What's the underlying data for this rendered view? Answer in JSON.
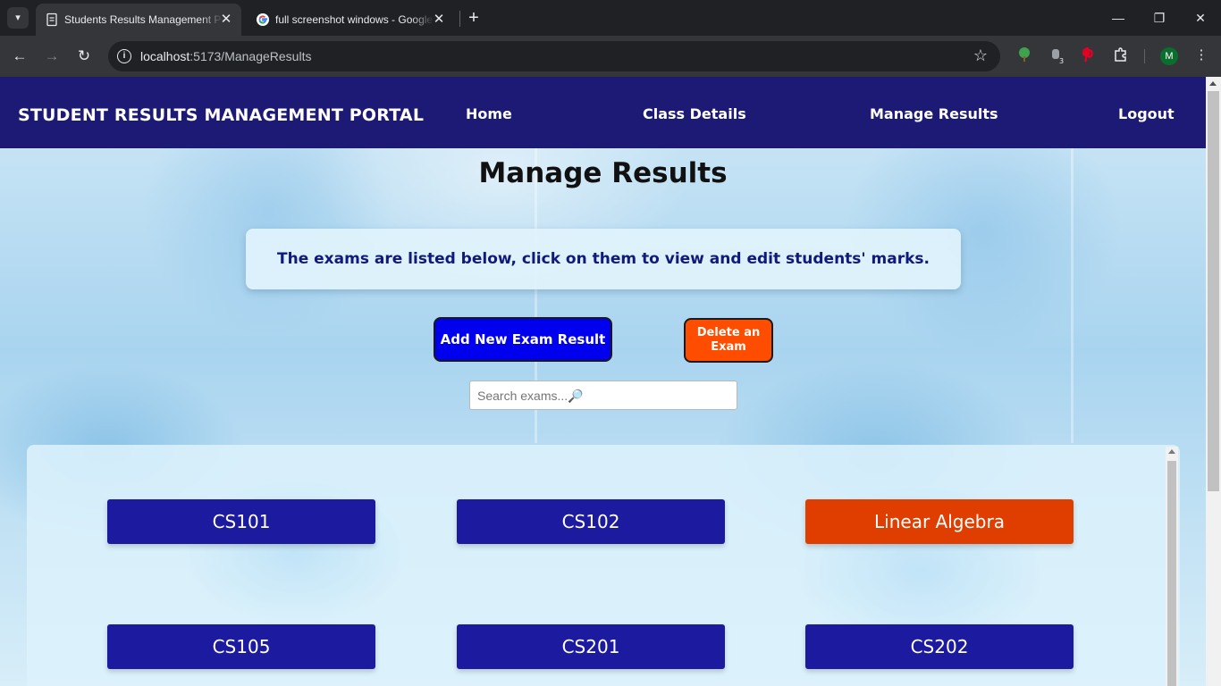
{
  "browser": {
    "tabs": [
      {
        "title": "Students Results Management Portal",
        "active": true
      },
      {
        "title": "full screenshot windows - Google Search",
        "active": false
      }
    ],
    "url_host": "localhost",
    "url_path": ":5173/ManageResults",
    "profile_initial": "M",
    "extension_badge": "3"
  },
  "portal_nav": {
    "brand": "STUDENT RESULTS MANAGEMENT PORTAL",
    "links": [
      "Home",
      "Class Details",
      "Manage Results",
      "Logout"
    ]
  },
  "page": {
    "title": "Manage Results",
    "info": "The exams are listed below, click on them to view and edit students' marks.",
    "add_button": "Add New Exam Result",
    "delete_button": "Delete an Exam",
    "search_placeholder": "Search exams...🔎"
  },
  "exams": [
    {
      "label": "CS101",
      "color": "#1c1a9e"
    },
    {
      "label": "CS102",
      "color": "#1c1a9e"
    },
    {
      "label": "Linear Algebra",
      "color": "#e03e00"
    },
    {
      "label": "CS105",
      "color": "#1c1a9e"
    },
    {
      "label": "CS201",
      "color": "#1c1a9e"
    },
    {
      "label": "CS202",
      "color": "#1c1a9e"
    }
  ],
  "colors": {
    "nav_bg": "#1c1a74",
    "add_button": "#0000ee",
    "delete_button": "#ff4d00",
    "info_text": "#101a7c"
  }
}
